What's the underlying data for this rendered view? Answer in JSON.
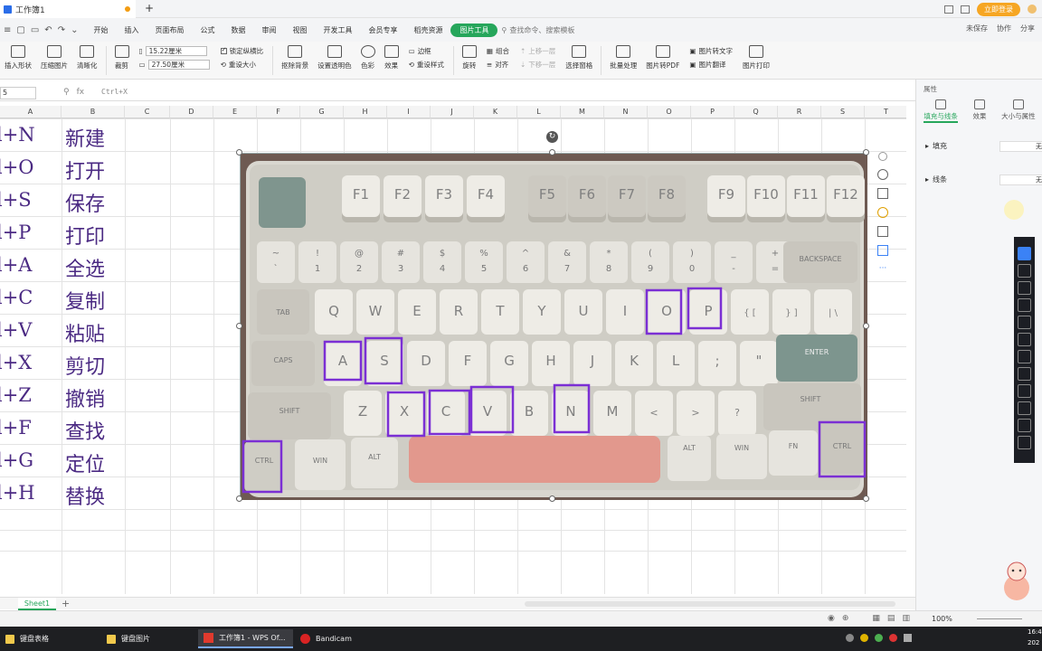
{
  "titlebar": {
    "doc_title": "工作簿1",
    "plus": "+",
    "login": "立即登录"
  },
  "menu": {
    "items": [
      "开始",
      "插入",
      "页面布局",
      "公式",
      "数据",
      "审阅",
      "视图",
      "开发工具",
      "会员专享",
      "稻壳资源"
    ],
    "active": "图片工具",
    "search_placeholder": "查找命令、搜索模板",
    "right": [
      "未保存",
      "协作",
      "分享"
    ]
  },
  "ribbon": {
    "buttons1": [
      "插入形状",
      "压缩图片",
      "清晰化",
      "裁剪"
    ],
    "width": "15.22厘米",
    "height": "27.50厘米",
    "lock_ratio": "锁定纵横比",
    "reset_size": "重设大小",
    "buttons2": [
      "抠除背景",
      "设置透明色",
      "色彩",
      "效果",
      "重设样式"
    ],
    "border": "边框",
    "rotate": "旋转",
    "combine": "组合",
    "align": "对齐",
    "up_layer": "上移一层",
    "down_layer": "下移一层",
    "select_pane": "选择窗格",
    "buttons3": [
      "批量处理",
      "图片转PDF",
      "图片转文字",
      "图片翻译",
      "图片打印"
    ]
  },
  "formula": {
    "name_box": "5",
    "fx": "fx",
    "content": "Ctrl+X"
  },
  "columns": [
    "A",
    "B",
    "C",
    "D",
    "E",
    "F",
    "G",
    "H",
    "I",
    "J",
    "K",
    "L",
    "M",
    "N",
    "O",
    "P",
    "Q",
    "R",
    "S",
    "T"
  ],
  "rows": [
    {
      "a": "l+N",
      "b": "新建"
    },
    {
      "a": "l+O",
      "b": "打开"
    },
    {
      "a": "l+S",
      "b": "保存"
    },
    {
      "a": "l+P",
      "b": "打印"
    },
    {
      "a": "l+A",
      "b": "全选"
    },
    {
      "a": "l+C",
      "b": "复制"
    },
    {
      "a": "l+V",
      "b": "粘贴"
    },
    {
      "a": "l+X",
      "b": "剪切"
    },
    {
      "a": "l+Z",
      "b": "撤销"
    },
    {
      "a": "l+F",
      "b": "查找"
    },
    {
      "a": "l+G",
      "b": "定位"
    },
    {
      "a": "l+H",
      "b": "替换"
    }
  ],
  "sheet": {
    "tab": "Sheet1",
    "add": "+"
  },
  "rightpanel": {
    "header": "属性",
    "tabs": [
      "填充与线条",
      "效果",
      "大小与属性"
    ],
    "fill_label": "填充",
    "fill_value": "无",
    "line_label": "线条",
    "line_value": "无"
  },
  "keyboard": {
    "fn_row": [
      "F1",
      "F2",
      "F3",
      "F4",
      "F5",
      "F6",
      "F7",
      "F8",
      "F9",
      "F10",
      "F11",
      "F12"
    ],
    "num_row_top": [
      "~",
      "!",
      "@",
      "#",
      "$",
      "%",
      "^",
      "&",
      "*",
      "(",
      ")",
      "_",
      "+"
    ],
    "num_row": [
      "`",
      "1",
      "2",
      "3",
      "4",
      "5",
      "6",
      "7",
      "8",
      "9",
      "0",
      "-",
      "="
    ],
    "backspace": "BACKSPACE",
    "tab": "TAB",
    "qrow": [
      "Q",
      "W",
      "E",
      "R",
      "T",
      "Y",
      "U",
      "I",
      "O",
      "P",
      "{ [",
      "} ]",
      "| \\"
    ],
    "caps": "CAPS",
    "arow": [
      "A",
      "S",
      "D",
      "F",
      "G",
      "H",
      "J",
      "K",
      "L",
      ";",
      "\""
    ],
    "enter": "ENTER",
    "shift": "SHIFT",
    "zrow": [
      "Z",
      "X",
      "C",
      "V",
      "B",
      "N",
      "M",
      "<",
      ">",
      "?"
    ],
    "ctrl": "CTRL",
    "win": "WIN",
    "alt": "ALT",
    "fn": "FN"
  },
  "status": {
    "zoom": "100%"
  },
  "taskbar": {
    "items": [
      "键盘表格",
      "键盘图片",
      "工作簿1 - WPS Of...",
      "Bandicam"
    ],
    "time": "16:4",
    "date": "202"
  },
  "colors": {
    "accent": "#26a65b",
    "highlight": "#7b2fd4",
    "text_purple": "#4b2a83"
  }
}
